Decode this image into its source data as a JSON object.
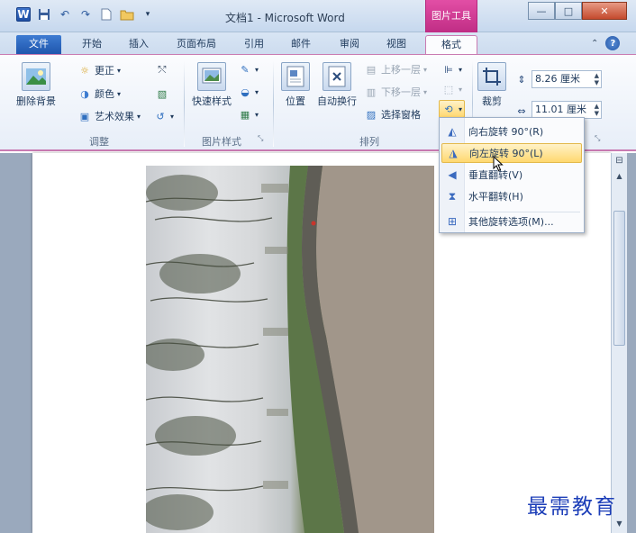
{
  "window": {
    "title": "文档1 - Microsoft Word",
    "context_tab": "图片工具",
    "minimize": "—",
    "maximize": "□",
    "close": "✕"
  },
  "tabs": [
    {
      "label": "文件"
    },
    {
      "label": "开始"
    },
    {
      "label": "插入"
    },
    {
      "label": "页面布局"
    },
    {
      "label": "引用"
    },
    {
      "label": "邮件"
    },
    {
      "label": "审阅"
    },
    {
      "label": "视图"
    },
    {
      "label": "格式"
    }
  ],
  "active_tab": "格式",
  "ribbon": {
    "adjust": {
      "label": "调整",
      "remove_bg": "删除背景",
      "corrections": "更正",
      "color": "颜色",
      "artistic": "艺术效果"
    },
    "picture_styles": {
      "label": "图片样式",
      "quick_styles": "快速样式"
    },
    "arrange": {
      "label": "排列",
      "position": "位置",
      "wrap_text": "自动换行",
      "bring_forward": "上移一层",
      "send_backward": "下移一层",
      "selection_pane": "选择窗格"
    },
    "size": {
      "crop": "裁剪",
      "height": "8.26 厘米",
      "width": "11.01 厘米"
    }
  },
  "rotate_menu": {
    "items": [
      {
        "label": "向右旋转 90°(R)",
        "icon": "rotate-right-icon"
      },
      {
        "label": "向左旋转 90°(L)",
        "icon": "rotate-left-icon",
        "highlighted": true
      },
      {
        "label": "垂直翻转(V)",
        "icon": "flip-vertical-icon"
      },
      {
        "label": "水平翻转(H)",
        "icon": "flip-horizontal-icon"
      },
      {
        "label": "其他旋转选项(M)...",
        "icon": "more-rotation-icon"
      }
    ]
  },
  "watermark": "最需教育",
  "colors": {
    "context_accent": "#c02d85",
    "file_tab": "#2a63bf",
    "menu_highlight": "#ffd870"
  }
}
